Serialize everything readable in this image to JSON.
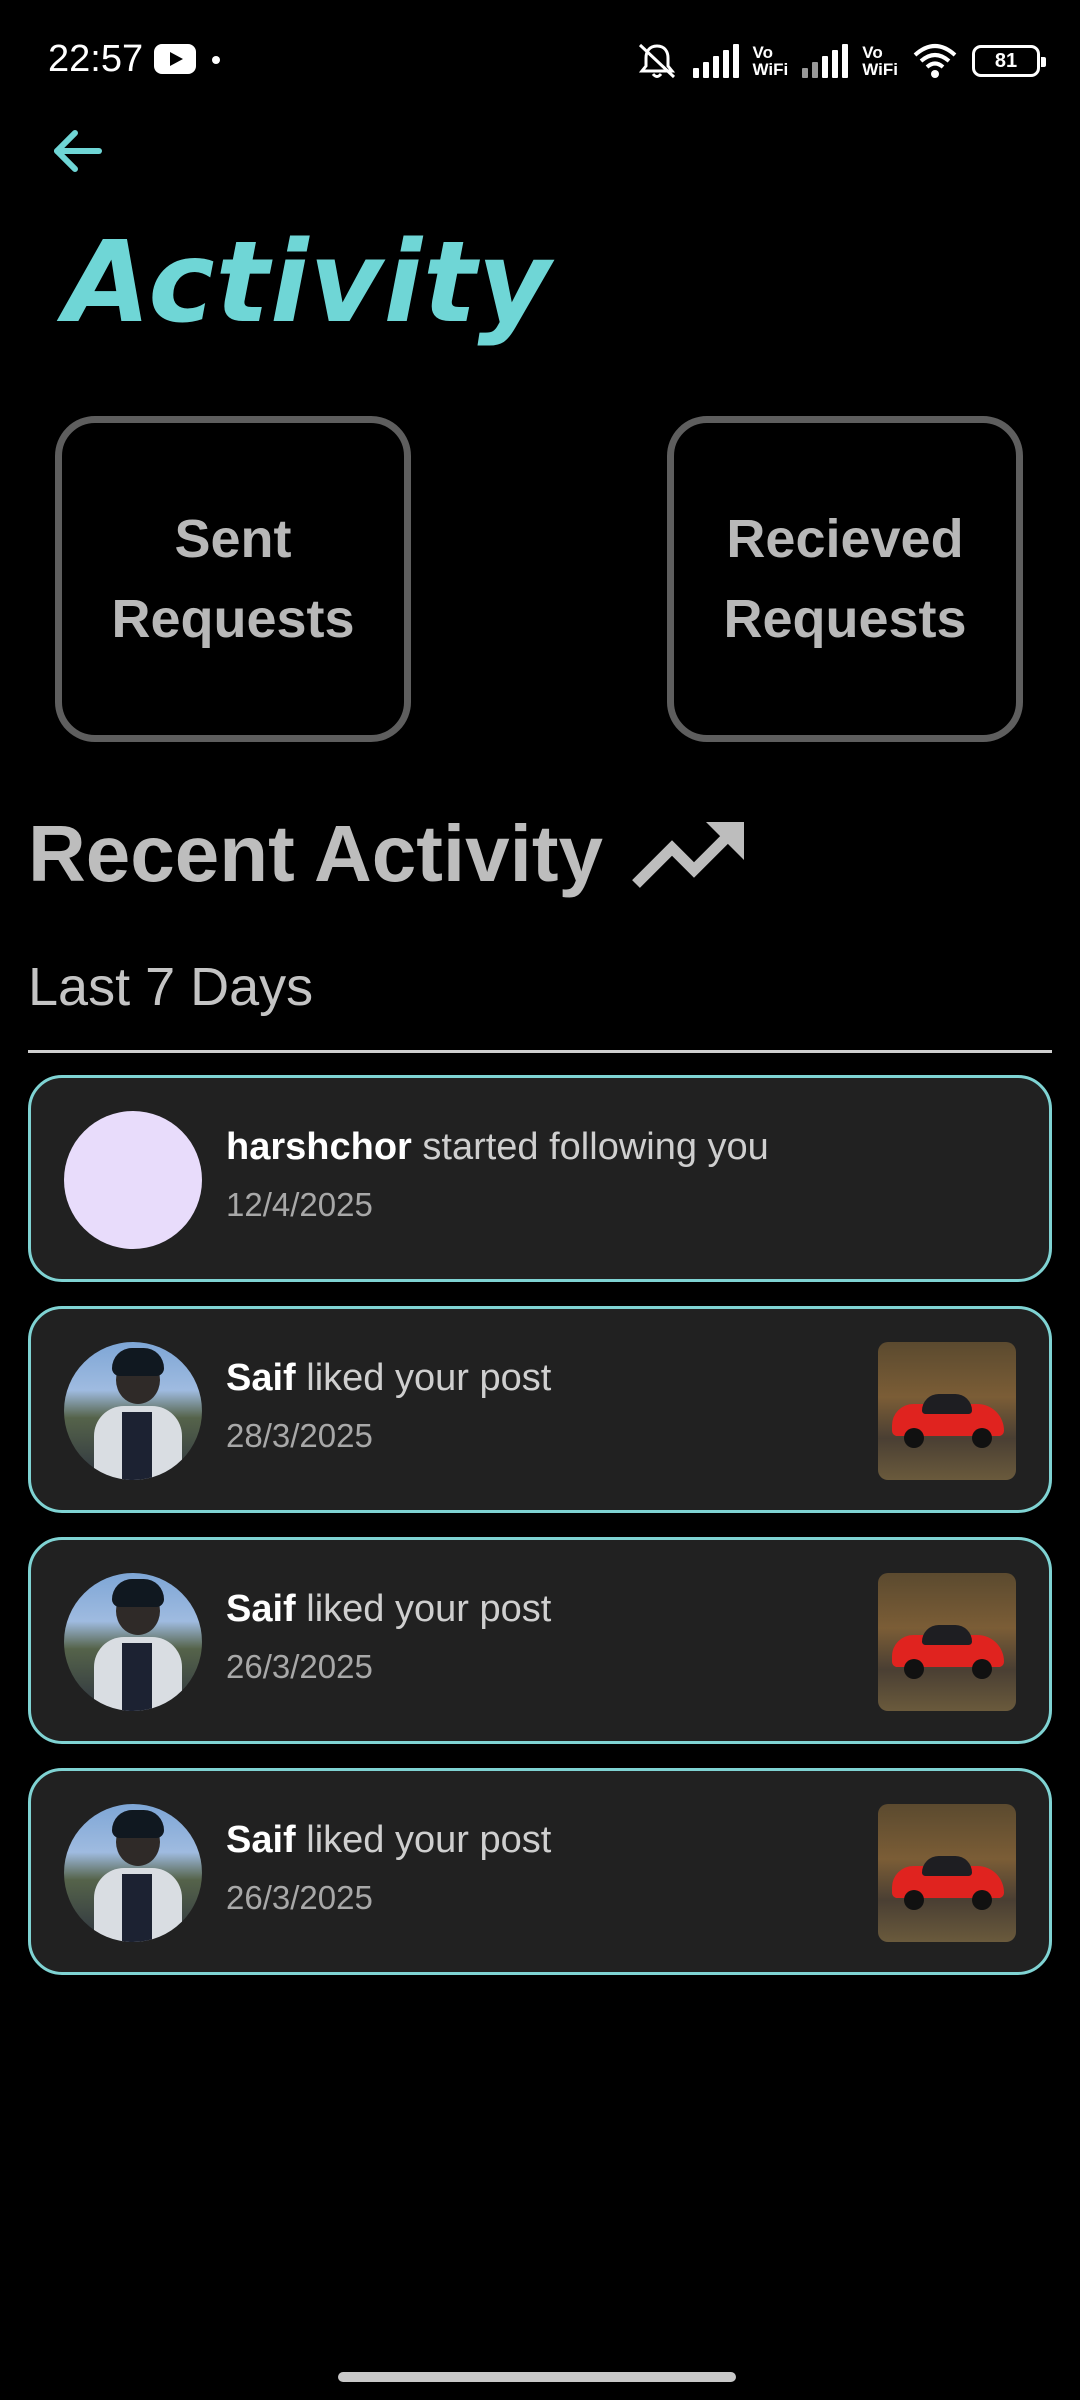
{
  "status_bar": {
    "time": "22:57",
    "battery": "81",
    "network_label_1": "Vo\nWiFi",
    "network_label_2": "Vo\nWiFi",
    "icons": [
      "youtube-icon",
      "notification-dot-icon",
      "mute-bell-icon",
      "signal-icon",
      "wifi-icon",
      "battery-icon"
    ]
  },
  "header": {
    "back_icon": "arrow-left-icon",
    "title": "Activity",
    "accent_color": "#6fd6d6"
  },
  "requests": {
    "sent_label": "Sent\nRequests",
    "received_label": "Recieved\nRequests"
  },
  "recent": {
    "title": "Recent Activity",
    "icon": "trending-up-icon",
    "period": "Last 7 Days"
  },
  "activities": [
    {
      "username": "harshchor",
      "action": " started following you",
      "date": "12/4/2025",
      "avatar": "plain",
      "has_post": false
    },
    {
      "username": "Saif",
      "action": " liked your post",
      "date": "28/3/2025",
      "avatar": "photo",
      "has_post": true
    },
    {
      "username": "Saif",
      "action": " liked your post",
      "date": "26/3/2025",
      "avatar": "photo",
      "has_post": true
    },
    {
      "username": "Saif",
      "action": " liked your post",
      "date": "26/3/2025",
      "avatar": "photo",
      "has_post": true
    }
  ]
}
